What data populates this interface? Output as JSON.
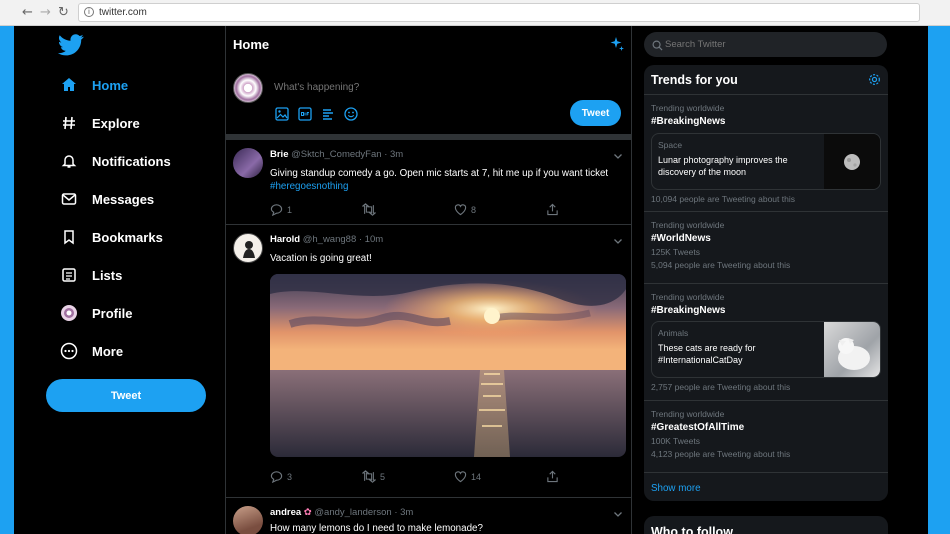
{
  "browser": {
    "url": "twitter.com",
    "back_glyph": "←",
    "forward_glyph": "→",
    "reload_glyph": "↻",
    "info_glyph": "i"
  },
  "colors": {
    "accent": "#1da1f2",
    "background": "#000000",
    "panel": "#15181c",
    "border": "#2f3336",
    "muted": "#6e767d"
  },
  "sidebar": {
    "logo_icon": "twitter-bird-icon",
    "items": [
      {
        "label": "Home",
        "icon": "home-icon",
        "active": true
      },
      {
        "label": "Explore",
        "icon": "hashtag-icon",
        "active": false
      },
      {
        "label": "Notifications",
        "icon": "bell-icon",
        "active": false
      },
      {
        "label": "Messages",
        "icon": "envelope-icon",
        "active": false
      },
      {
        "label": "Bookmarks",
        "icon": "bookmark-icon",
        "active": false
      },
      {
        "label": "Lists",
        "icon": "list-icon",
        "active": false
      },
      {
        "label": "Profile",
        "icon": "avatar-icon",
        "active": false
      },
      {
        "label": "More",
        "icon": "more-dots-icon",
        "active": false
      }
    ],
    "tweet_button": "Tweet"
  },
  "timeline": {
    "title": "Home",
    "compose": {
      "placeholder": "What's happening?",
      "tweet_button": "Tweet",
      "icons": [
        "image-icon",
        "gif-icon",
        "poll-icon",
        "emoji-icon"
      ]
    },
    "tweets": [
      {
        "name": "Brie",
        "handle": "@Sktch_ComedyFan",
        "time": "· 3m",
        "text": "Giving standup comedy a go. Open mic starts at 7, hit me up if you want ticket ",
        "link": "#heregoesnothing",
        "replies": "1",
        "retweets": "",
        "likes": "8"
      },
      {
        "name": "Harold",
        "handle": "@h_wang88",
        "time": "· 10m",
        "text": "Vacation is going great!",
        "replies": "3",
        "retweets": "5",
        "likes": "14"
      },
      {
        "name": "andrea",
        "handle": "@andy_landerson",
        "time": "· 3m",
        "text": "How many lemons do I need to make lemonade?"
      }
    ]
  },
  "search": {
    "placeholder": "Search Twitter"
  },
  "trends": {
    "title": "Trends for you",
    "items": [
      {
        "context": "Trending worldwide",
        "tag": "#BreakingNews"
      },
      {
        "context": "Trending worldwide",
        "tag": "#WorldNews",
        "tweets": "125K Tweets",
        "people": "5,094 people are Tweeting about this"
      },
      {
        "context": "Trending worldwide",
        "tag": "#BreakingNews"
      },
      {
        "context": "Trending worldwide",
        "tag": "#GreatestOfAllTime",
        "tweets": "100K Tweets",
        "people": "4,123 people are Tweeting about this"
      }
    ],
    "cards": [
      {
        "category": "Space",
        "text": "Lunar photography improves the discovery of the moon",
        "people": "10,094 people are Tweeting about this"
      },
      {
        "category": "Animals",
        "text": "These cats are ready for #InternationalCatDay",
        "people": "2,757 people are Tweeting about this"
      }
    ],
    "show_more": "Show more"
  },
  "who_to_follow": {
    "title": "Who to follow"
  }
}
